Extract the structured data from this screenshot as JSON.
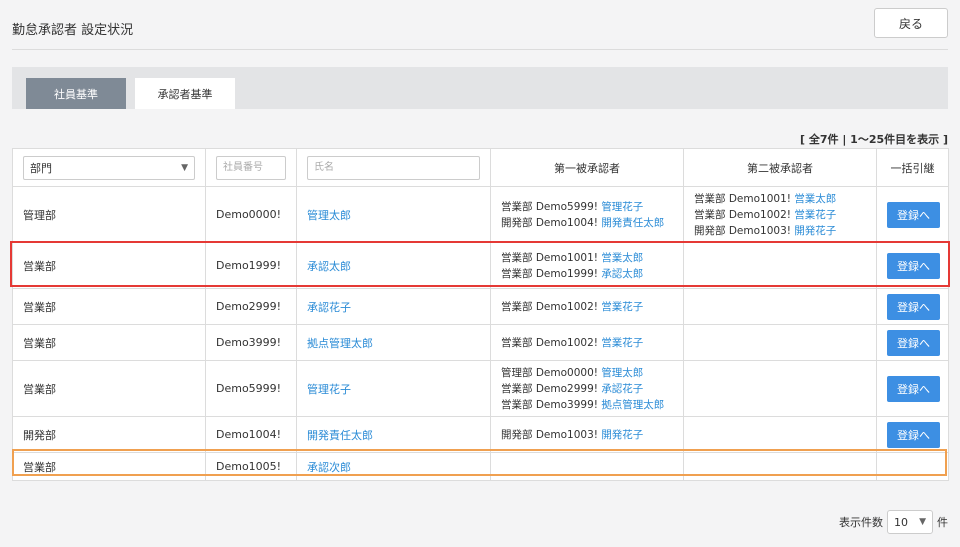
{
  "header": {
    "title": "勤怠承認者 設定状況",
    "back_label": "戻る"
  },
  "tabs": [
    {
      "label": "社員基準",
      "active": true
    },
    {
      "label": "承認者基準",
      "active": false
    }
  ],
  "count_text": "[ 全7件 | 1〜25件目を表示 ]",
  "filters": {
    "department_selected": "部門",
    "employee_no_placeholder": "社員番号",
    "name_placeholder": "氏名"
  },
  "columns": {
    "first_approver": "第一被承認者",
    "second_approver": "第二被承認者",
    "bulk": "一括引継"
  },
  "register_label": "登録へ",
  "rows": [
    {
      "dept": "管理部",
      "emp_no": "Demo0000!",
      "name": "管理太郎",
      "first": [
        {
          "prefix": "営業部 Demo5999! ",
          "name": "管理花子"
        },
        {
          "prefix": "開発部 Demo1004! ",
          "name": "開発責任太郎"
        }
      ],
      "second": [
        {
          "prefix": "営業部 Demo1001! ",
          "name": "営業太郎"
        },
        {
          "prefix": "営業部 Demo1002! ",
          "name": "営業花子"
        },
        {
          "prefix": "開発部 Demo1003! ",
          "name": "開発花子"
        }
      ]
    },
    {
      "dept": "営業部",
      "emp_no": "Demo1999!",
      "name": "承認太郎",
      "first": [
        {
          "prefix": "営業部 Demo1001! ",
          "name": "営業太郎"
        },
        {
          "prefix": "営業部 Demo1999! ",
          "name": "承認太郎"
        }
      ],
      "second": []
    },
    {
      "dept": "営業部",
      "emp_no": "Demo2999!",
      "name": "承認花子",
      "first": [
        {
          "prefix": "営業部 Demo1002! ",
          "name": "営業花子"
        }
      ],
      "second": []
    },
    {
      "dept": "営業部",
      "emp_no": "Demo3999!",
      "name": "拠点管理太郎",
      "first": [
        {
          "prefix": "営業部 Demo1002! ",
          "name": "営業花子"
        }
      ],
      "second": []
    },
    {
      "dept": "営業部",
      "emp_no": "Demo5999!",
      "name": "管理花子",
      "first": [
        {
          "prefix": "管理部 Demo0000! ",
          "name": "管理太郎"
        },
        {
          "prefix": "営業部 Demo2999! ",
          "name": "承認花子"
        },
        {
          "prefix": "営業部 Demo3999! ",
          "name": "拠点管理太郎"
        }
      ],
      "second": []
    },
    {
      "dept": "開発部",
      "emp_no": "Demo1004!",
      "name": "開発責任太郎",
      "first": [
        {
          "prefix": "開発部 Demo1003! ",
          "name": "開発花子"
        }
      ],
      "second": []
    },
    {
      "dept": "営業部",
      "emp_no": "Demo1005!",
      "name": "承認次郎",
      "first": [],
      "second": []
    }
  ],
  "footer": {
    "label": "表示件数",
    "page_size": "10",
    "unit": "件"
  }
}
